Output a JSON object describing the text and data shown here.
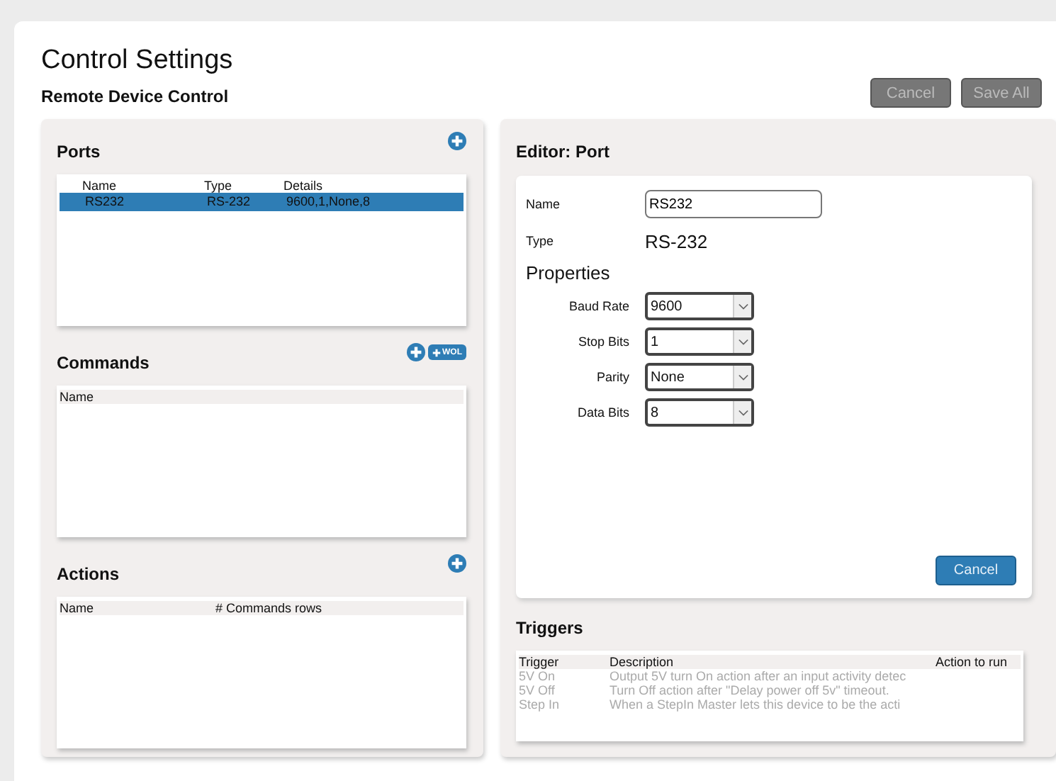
{
  "page": {
    "title": "Control Settings",
    "subtitle": "Remote Device Control"
  },
  "buttons": [
    {
      "label": "Cancel",
      "disabled": true
    },
    {
      "label": "Save All",
      "disabled": true
    }
  ],
  "ports": {
    "title": "Ports",
    "columns": [
      "Name",
      "Type",
      "Details"
    ],
    "rows": [
      {
        "cells": [
          "RS232",
          "RS-232",
          "9600,1,None,8"
        ],
        "selected": true
      }
    ]
  },
  "commands": {
    "title": "Commands",
    "wol_label": "WOL",
    "columns": [
      "Name"
    ]
  },
  "actions": {
    "title": "Actions",
    "columns": [
      "Name",
      "# Commands rows"
    ]
  },
  "editor": {
    "title": "Editor: Port",
    "name_label": "Name",
    "name_value": "RS232",
    "type_label": "Type",
    "type_value": "RS-232",
    "properties_title": "Properties",
    "properties": [
      {
        "label": "Baud Rate",
        "value": "9600"
      },
      {
        "label": "Stop Bits",
        "value": "1"
      },
      {
        "label": "Parity",
        "value": "None"
      },
      {
        "label": "Data Bits",
        "value": "8"
      }
    ],
    "cancel": "Cancel"
  },
  "triggers": {
    "title": "Triggers",
    "columns": [
      "Trigger",
      "Description",
      "Action to run"
    ],
    "rows": [
      {
        "cells": [
          "5V On",
          "Output 5V turn On action after an input activity detec"
        ]
      },
      {
        "cells": [
          "5V Off",
          "Turn Off action after \"Delay power off 5v\" timeout."
        ]
      },
      {
        "cells": [
          "Step In",
          "When a StepIn Master lets this device to be the acti"
        ]
      }
    ]
  }
}
